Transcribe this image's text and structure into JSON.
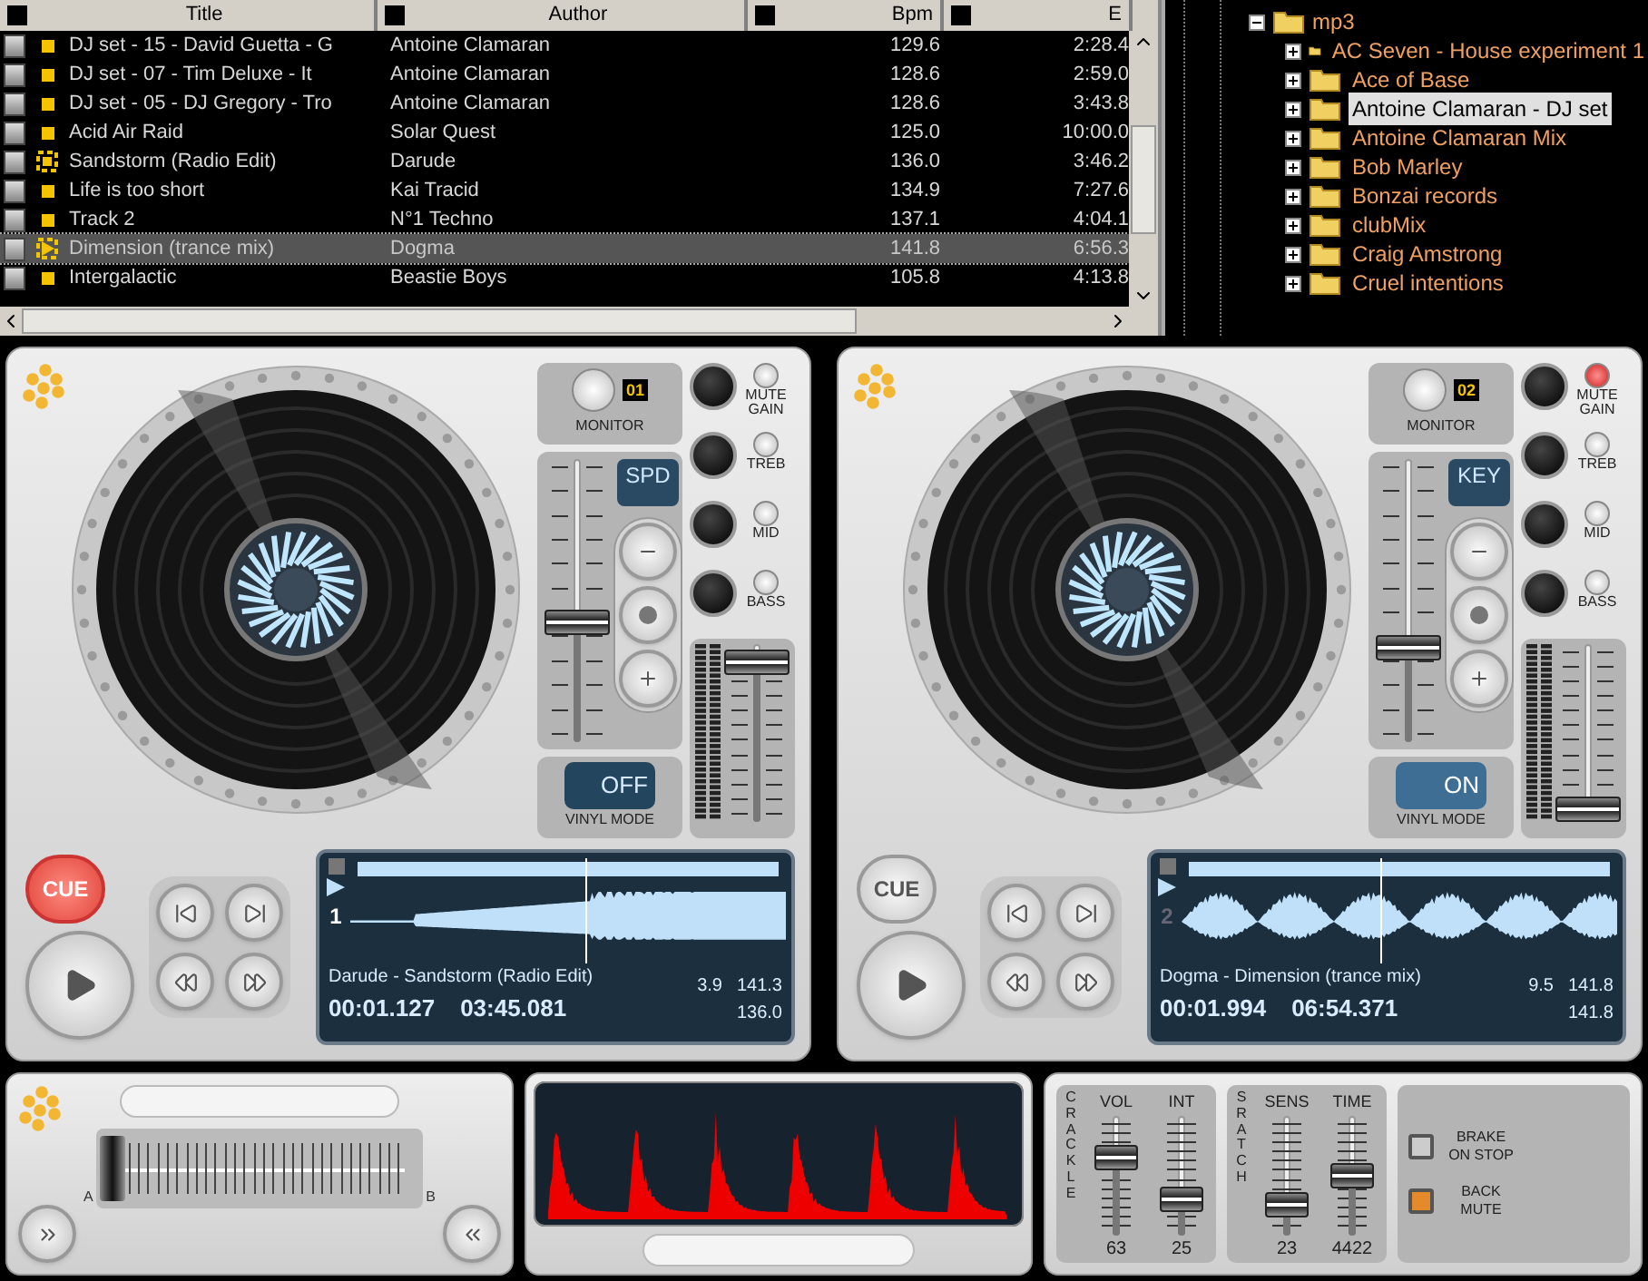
{
  "library": {
    "columns": [
      "Title",
      "Author",
      "Bpm",
      "E"
    ],
    "rows": [
      {
        "kind": "track",
        "selected": false,
        "title": "DJ set - 15 - David Guetta - G",
        "author": "Antoine Clamaran",
        "bpm": "129.6",
        "length": "2:28.4"
      },
      {
        "kind": "track",
        "selected": false,
        "title": "DJ set - 07 - Tim Deluxe - It",
        "author": "Antoine Clamaran",
        "bpm": "128.6",
        "length": "2:59.0"
      },
      {
        "kind": "track",
        "selected": false,
        "title": "DJ set - 05 - DJ Gregory - Tro",
        "author": "Antoine Clamaran",
        "bpm": "128.6",
        "length": "3:43.8"
      },
      {
        "kind": "track",
        "selected": false,
        "title": "Acid Air Raid",
        "author": "Solar Quest",
        "bpm": "125.0",
        "length": "10:00.0"
      },
      {
        "kind": "loaded",
        "selected": false,
        "title": "Sandstorm (Radio Edit)",
        "author": "Darude",
        "bpm": "136.0",
        "length": "3:46.2"
      },
      {
        "kind": "track",
        "selected": false,
        "title": "Life is too short",
        "author": "Kai Tracid",
        "bpm": "134.9",
        "length": "7:27.6"
      },
      {
        "kind": "track",
        "selected": false,
        "title": "Track  2",
        "author": "N°1 Techno",
        "bpm": "137.1",
        "length": "4:04.1"
      },
      {
        "kind": "playing",
        "selected": true,
        "title": "Dimension (trance mix)",
        "author": "Dogma",
        "bpm": "141.8",
        "length": "6:56.3"
      },
      {
        "kind": "track",
        "selected": false,
        "title": "Intergalactic",
        "author": "Beastie Boys",
        "bpm": "105.8",
        "length": "4:13.8"
      }
    ]
  },
  "folders": {
    "label": "mp3",
    "expanded": true,
    "children": [
      {
        "label": "AC Seven - House experiment 1",
        "selected": false
      },
      {
        "label": "Ace of Base",
        "selected": false
      },
      {
        "label": "Antoine Clamaran - DJ set",
        "selected": true
      },
      {
        "label": "Antoine Clamaran Mix",
        "selected": false
      },
      {
        "label": "Bob Marley",
        "selected": false
      },
      {
        "label": "Bonzai records",
        "selected": false
      },
      {
        "label": "clubMix",
        "selected": false
      },
      {
        "label": "Craig Amstrong",
        "selected": false
      },
      {
        "label": "Cruel intentions",
        "selected": false
      }
    ]
  },
  "decks": [
    {
      "badge": "01",
      "monitor": "MONITOR",
      "pitch": {
        "label": "SPD",
        "level": 0.42
      },
      "volume": {
        "level": 0.9
      },
      "knobs": [
        {
          "label": "MUTE GAIN",
          "on": false
        },
        {
          "label": "TREB",
          "on": false
        },
        {
          "label": "MID",
          "on": false
        },
        {
          "label": "BASS",
          "on": false
        }
      ],
      "vinyl": {
        "label": "VINYL MODE",
        "state": "OFF",
        "on": false
      },
      "cue": {
        "label": "CUE",
        "on": true
      },
      "display": {
        "number": "1",
        "title": "Darude - Sandstorm (Radio Edit)",
        "elapsed": "00:01.127",
        "remaining": "03:45.081",
        "pitch": "3.9",
        "bpm": "141.3",
        "original_bpm": "136.0"
      }
    },
    {
      "badge": "02",
      "monitor": "MONITOR",
      "pitch": {
        "label": "KEY",
        "level": 0.33
      },
      "volume": {
        "level": 0.07
      },
      "knobs": [
        {
          "label": "MUTE GAIN",
          "on": true
        },
        {
          "label": "TREB",
          "on": false
        },
        {
          "label": "MID",
          "on": false
        },
        {
          "label": "BASS",
          "on": false
        }
      ],
      "vinyl": {
        "label": "VINYL MODE",
        "state": "ON",
        "on": true
      },
      "cue": {
        "label": "CUE",
        "on": false
      },
      "display": {
        "number": "2",
        "title": "Dogma - Dimension (trance mix)",
        "elapsed": "00:01.994",
        "remaining": "06:54.371",
        "pitch": "9.5",
        "bpm": "141.8",
        "original_bpm": "141.8"
      }
    }
  ],
  "crossfader": {
    "label_a": "A",
    "label_b": "B",
    "level": 0.05
  },
  "effects": {
    "groups": [
      {
        "title": "CRACKLE",
        "sliders": [
          {
            "label": "VOL",
            "value": "63",
            "level": 0.65
          },
          {
            "label": "INT",
            "value": "25",
            "level": 0.3
          }
        ]
      },
      {
        "title": "SRATCH",
        "sliders": [
          {
            "label": "SENS",
            "value": "23",
            "level": 0.25
          },
          {
            "label": "TIME",
            "value": "4422",
            "level": 0.5
          }
        ]
      }
    ],
    "buttons": [
      {
        "label": "BRAKE ON STOP",
        "on": false
      },
      {
        "label": "BACK MUTE",
        "on": true
      }
    ]
  }
}
